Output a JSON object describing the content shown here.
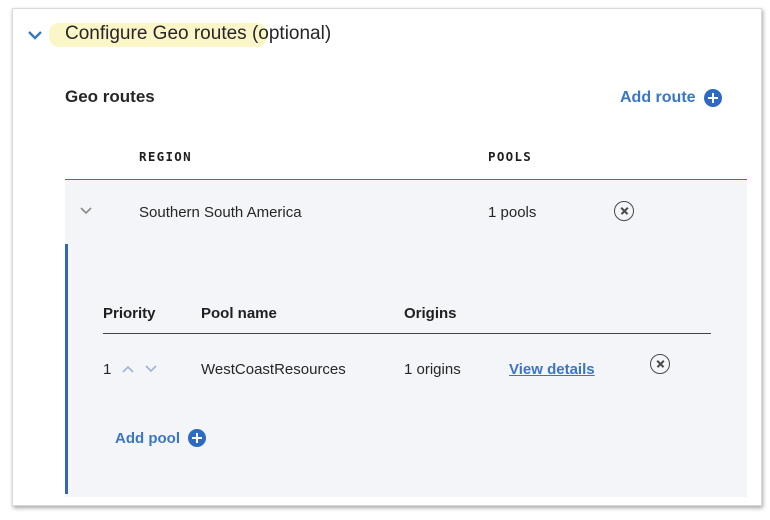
{
  "section": {
    "title": "Configure Geo routes",
    "title_suffix": "(optional)"
  },
  "geo_routes": {
    "heading": "Geo routes",
    "add_route_label": "Add route",
    "columns": {
      "region": "REGION",
      "pools": "POOLS"
    },
    "route": {
      "region": "Southern South America",
      "pool_count": "1 pools"
    }
  },
  "pools_table": {
    "columns": {
      "priority": "Priority",
      "pool_name": "Pool name",
      "origins": "Origins"
    },
    "rows": [
      {
        "priority": "1",
        "pool_name": "WestCoastResources",
        "origins": "1 origins",
        "action": "View details"
      }
    ],
    "add_pool_label": "Add pool"
  },
  "colors": {
    "accent": "#3a76c4",
    "highlight": "#fbf6c8",
    "panel_bg": "#f3f5f8",
    "panel_border": "#3566b4"
  },
  "icons": {
    "section_toggle": "chevron-down-icon",
    "route_toggle": "chevron-down-icon",
    "add": "plus-circle-icon",
    "remove": "close-circle-icon",
    "priority_up": "chevron-up-icon",
    "priority_down": "chevron-down-icon"
  }
}
